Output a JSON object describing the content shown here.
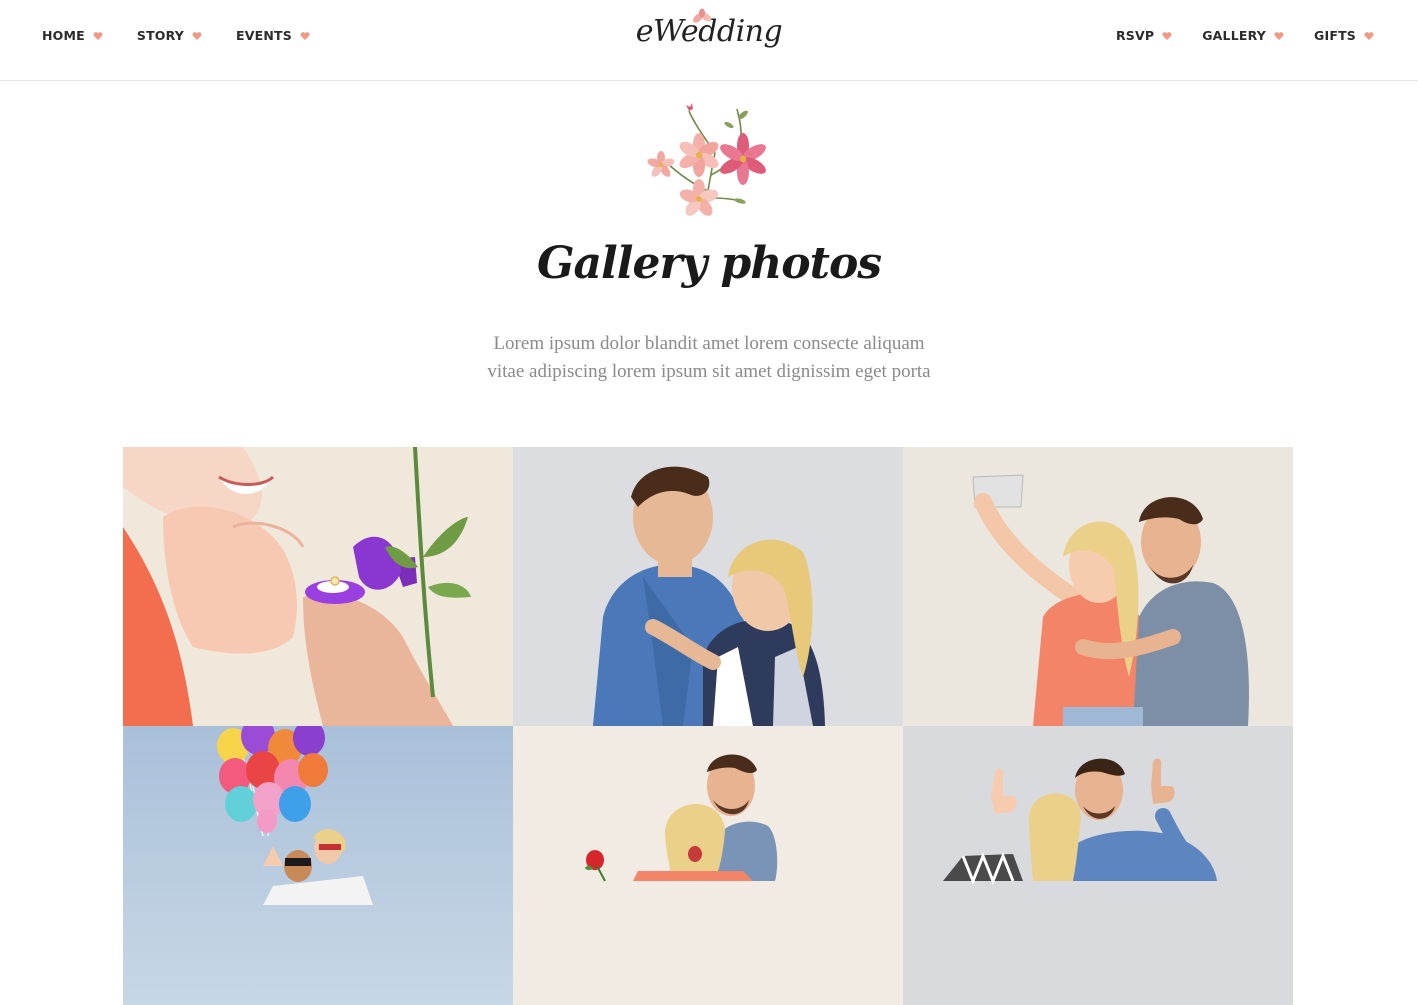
{
  "nav": {
    "left": [
      {
        "label": "HOME"
      },
      {
        "label": "STORY"
      },
      {
        "label": "EVENTS"
      }
    ],
    "right": [
      {
        "label": "RSVP"
      },
      {
        "label": "GALLERY"
      },
      {
        "label": "GIFTS"
      }
    ],
    "heart_color": "#f09a86"
  },
  "logo": {
    "text": "eWedding"
  },
  "section": {
    "title": "Gallery photos",
    "subtitle_line1": "Lorem ipsum dolor blandit amet lorem consecte aliquam",
    "subtitle_line2": "vitae adipiscing lorem ipsum sit amet dignissim eget porta"
  },
  "gallery": {
    "photos": [
      {
        "subject": "proposal-ring-rose"
      },
      {
        "subject": "couple-embrace"
      },
      {
        "subject": "couple-selfie"
      },
      {
        "subject": "couple-balloons"
      },
      {
        "subject": "couple-rose"
      },
      {
        "subject": "couple-thumbs-up"
      }
    ]
  },
  "colors": {
    "accent": "#f09a86",
    "text_dark": "#2b2b2b",
    "text_muted": "#8a8a8a"
  }
}
